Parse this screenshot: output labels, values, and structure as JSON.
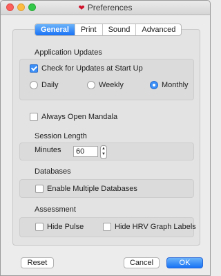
{
  "window": {
    "title": "Preferences",
    "title_icon": "heart-icon"
  },
  "tabs": [
    {
      "label": "General",
      "active": true
    },
    {
      "label": "Print",
      "active": false
    },
    {
      "label": "Sound",
      "active": false
    },
    {
      "label": "Advanced",
      "active": false
    }
  ],
  "application_updates": {
    "heading": "Application Updates",
    "check_label": "Check for Updates at Start Up",
    "check_checked": true,
    "options": [
      {
        "label": "Daily",
        "selected": false
      },
      {
        "label": "Weekly",
        "selected": false
      },
      {
        "label": "Monthly",
        "selected": true
      }
    ]
  },
  "always_open": {
    "label": "Always Open Mandala",
    "checked": false
  },
  "session_length": {
    "heading": "Session Length",
    "minutes_label": "Minutes",
    "minutes_value": "60"
  },
  "databases": {
    "heading": "Databases",
    "enable_label": "Enable Multiple Databases",
    "enable_checked": false
  },
  "assessment": {
    "heading": "Assessment",
    "hide_pulse_label": "Hide Pulse",
    "hide_pulse_checked": false,
    "hide_hrv_label": "Hide HRV Graph Labels",
    "hide_hrv_checked": false
  },
  "buttons": {
    "reset": "Reset",
    "cancel": "Cancel",
    "ok": "OK"
  },
  "colors": {
    "accent": "#1872f5",
    "heart": "#d0112b"
  }
}
